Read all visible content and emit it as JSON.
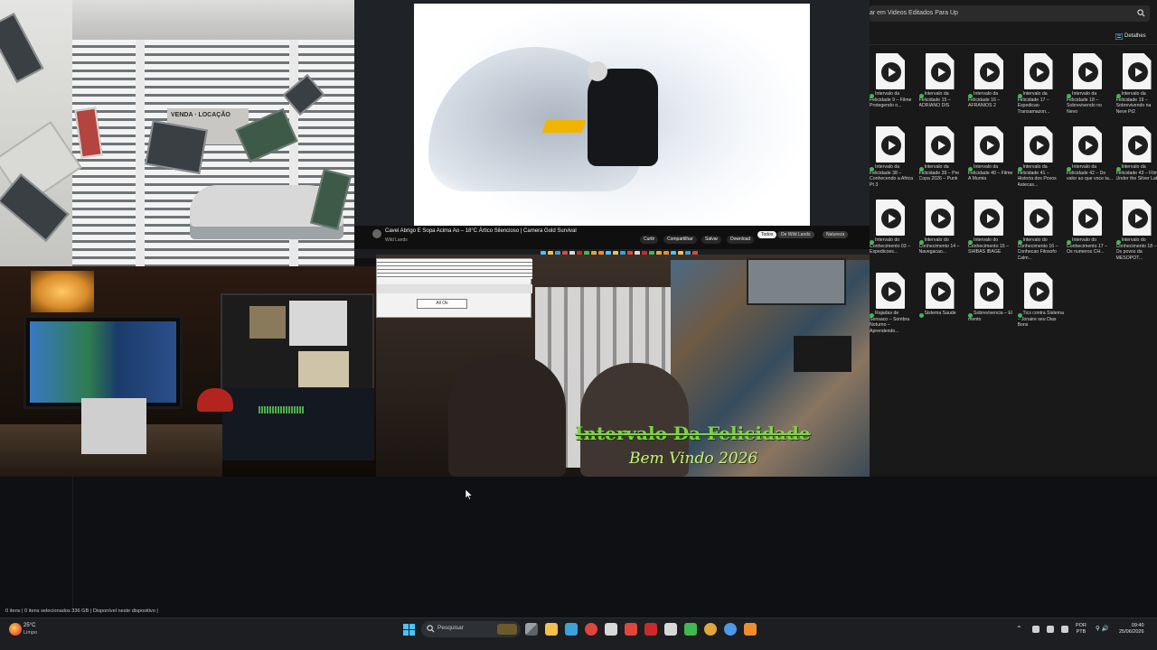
{
  "colors": {
    "taskbar": "#1c1e22",
    "explorer_bg": "#191919",
    "overlay_green": "#7fd24a",
    "status_green": "#3fb950",
    "accent_blue": "#4cc2ff"
  },
  "camera_gate": {
    "sign_text": "VENDA · LOCAÇÃO"
  },
  "youtube": {
    "title": "Cavei Abrigo E Sopa Acima Ao – 18°C Ártico Silencioso | Camera Gold Survival",
    "channel": "Wild Lands",
    "actions": [
      "Curtir",
      "Compartilhar",
      "Salvar",
      "Download"
    ],
    "chips": [
      {
        "label": "Todos",
        "active": true
      },
      {
        "label": "De Wild Lands",
        "active": false
      },
      {
        "label": "Natureza",
        "active": false
      }
    ]
  },
  "dialog": {
    "ok_label": "All Ok"
  },
  "overlay": {
    "title": "Intervalo Da Felicidade",
    "subtitle": "Bem Vindo 2026"
  },
  "explorer": {
    "path": "ar em Videos Editados Para Up",
    "details_label": "Detalhes",
    "files": [
      "Intervalo da Felicidade 9 – Filme Protegendo o...",
      "Intervalo da Felicidade 15 – ADRIANO DIS",
      "Intervalo da Felicidade 16 – AFRANIOS 2",
      "Intervalo da Felicidade 17 – Expedicao Transamazon...",
      "Intervalo da Felicidade 18 – Sobrevivendo no Nevo",
      "Intervalo da Felicidade 19 – Sobrevivendo na Neve Pt2",
      "Intervalo da Felicidade 38 – Conhecendo a Africa Pt 3",
      "Intervalo da Felicidade 39 – Pre Copa 2026 – Punk",
      "Intervalo da Felicidade 40 – Filme A Mumia",
      "Intervalo da Felicidade 41 – Historia dos Povos Astecas...",
      "Intervalo da Felicidade 42 – Do valor ao que voce ta...",
      "Intervalo da Felicidade 43 – Filme Under the Silver Lake",
      "Intervalo do Conhecimento 03 – Expedicoes...",
      "Intervalo do Conhecimento 14 – Navegacao...",
      "Intervalo do Conhecimento 15 – SHIBAS IBAGE",
      "Intervalo do Conhecimento 16 – Conhecao Filosofo Calm...",
      "Intervalo do Conhecimento 17 – Os numeros CH...",
      "Intervalo do Conhecimento 18 – Os povos da MESOPOT...",
      "Rajadas de Sensaco – Sombra Noturno – Aprendendo...",
      "Sistema Saude",
      "Sobrevivencia – El mento",
      "Tics contra Sistema – Jonaire seu Dias Bons"
    ],
    "status_text": "0 itens  |  0 itens selecionados 336 GB  |  Disponível neste dispositivo  |"
  },
  "taskbar": {
    "weather_temp": "25°C",
    "weather_cond": "Limpo",
    "search_placeholder": "Pesquisar",
    "lang_top": "POR",
    "lang_bottom": "PTB",
    "volume": "⚲ 🔊",
    "time": "09:40",
    "date": "25/06/2026",
    "apps": [
      {
        "name": "task-view",
        "color": "#9aa0a6"
      },
      {
        "name": "file-explorer",
        "color": "#f2c14e"
      },
      {
        "name": "edge",
        "color": "#3aa3d9"
      },
      {
        "name": "chrome",
        "color": "#e0463a"
      },
      {
        "name": "store",
        "color": "#d8d8d8"
      },
      {
        "name": "photos",
        "color": "#e0463a"
      },
      {
        "name": "opera",
        "color": "#cc2a2a"
      },
      {
        "name": "steam",
        "color": "#d8d8d8"
      },
      {
        "name": "spotify",
        "color": "#3fb950"
      },
      {
        "name": "chrome-profile-2",
        "color": "#e0a83a"
      },
      {
        "name": "chrome-profile-3",
        "color": "#4c9be8"
      },
      {
        "name": "vlc",
        "color": "#f08c2a"
      }
    ]
  }
}
